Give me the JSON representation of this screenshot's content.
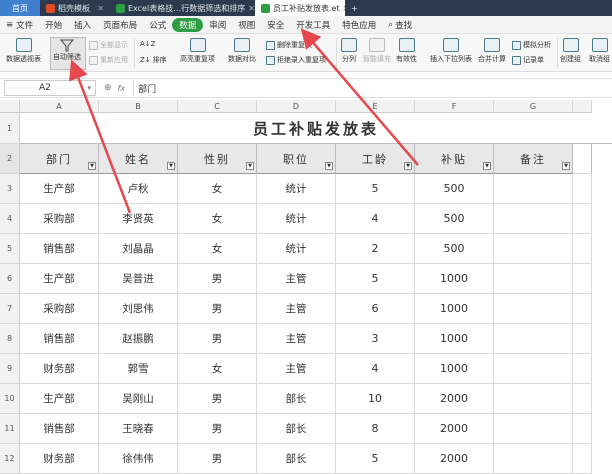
{
  "tabs": [
    {
      "label": "首页",
      "cls": "home"
    },
    {
      "label": "稻壳模板",
      "cls": "t1",
      "color": "#e04b2a"
    },
    {
      "label": "Excel表格技…行数据筛选和排序",
      "cls": "t2",
      "color": "#2e9e45"
    },
    {
      "label": "员工补贴发放表.et",
      "cls": "t3",
      "color": "#2e9e45"
    }
  ],
  "menu": {
    "file": "文件",
    "items": [
      "开始",
      "插入",
      "页面布局",
      "公式",
      "数据",
      "审阅",
      "视图",
      "安全",
      "开发工具",
      "特色应用"
    ],
    "active": "数据",
    "search": "查找"
  },
  "ribbon": {
    "pivot": "数据透视表",
    "autofilter": "自动筛选",
    "show_all": "全部显示",
    "reapply": "重新应用",
    "sort": "排序",
    "highlight_dup": "高亮重复项",
    "compare": "数据对比",
    "remove_dup": "删除重复项",
    "reject_dup": "拒绝录入重复项",
    "split": "分列",
    "smart_fill": "智能填充",
    "validity": "有效性",
    "dropdown": "插入下拉列表",
    "consolidate": "合并计算",
    "simulate": "模拟分析",
    "record": "记录单",
    "group": "创建组",
    "ungroup": "取消组"
  },
  "formula_bar": {
    "cell_ref": "A2",
    "fx": "fx",
    "value": "部门"
  },
  "columns": [
    "A",
    "B",
    "C",
    "D",
    "E",
    "F",
    "G"
  ],
  "rows": [
    "1",
    "2",
    "3",
    "4",
    "5",
    "6",
    "7",
    "8",
    "9",
    "10",
    "11",
    "12"
  ],
  "sheet": {
    "title": "员工补贴发放表",
    "headers": [
      "部门",
      "姓名",
      "性别",
      "职位",
      "工龄",
      "补贴",
      "备注"
    ],
    "data": [
      [
        "生产部",
        "卢秋",
        "女",
        "统计",
        "5",
        "500",
        ""
      ],
      [
        "采购部",
        "李贤英",
        "女",
        "统计",
        "4",
        "500",
        ""
      ],
      [
        "销售部",
        "刘晶晶",
        "女",
        "统计",
        "2",
        "500",
        ""
      ],
      [
        "生产部",
        "吴普进",
        "男",
        "主管",
        "5",
        "1000",
        ""
      ],
      [
        "采购部",
        "刘思伟",
        "男",
        "主管",
        "6",
        "1000",
        ""
      ],
      [
        "销售部",
        "赵振鹏",
        "男",
        "主管",
        "3",
        "1000",
        ""
      ],
      [
        "财务部",
        "郭雪",
        "女",
        "主管",
        "4",
        "1000",
        ""
      ],
      [
        "生产部",
        "吴刚山",
        "男",
        "部长",
        "10",
        "2000",
        ""
      ],
      [
        "销售部",
        "王晓春",
        "男",
        "部长",
        "8",
        "2000",
        ""
      ],
      [
        "财务部",
        "徐伟伟",
        "男",
        "部长",
        "5",
        "2000",
        ""
      ]
    ]
  },
  "accent": "#2e9e45",
  "arrow_color": "#e5484d"
}
